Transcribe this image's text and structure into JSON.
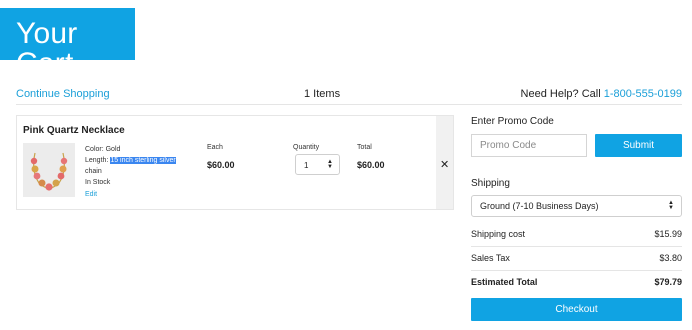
{
  "header": {
    "title": "Your Cart"
  },
  "topbar": {
    "continue_label": "Continue Shopping",
    "items_count": "1 Items",
    "help_text": "Need Help? Call ",
    "phone": "1-800-555-0199"
  },
  "cart": {
    "items": [
      {
        "name": "Pink Quartz Necklace",
        "color_text": "Color: Gold",
        "length_prefix": "Length: ",
        "length_value": "15 inch sterling silver",
        "length_suffix": "chain",
        "stock": "In Stock",
        "edit_label": "Edit",
        "each_label": "Each",
        "each_value": "$60.00",
        "quantity_label": "Quantity",
        "quantity": "1",
        "total_label": "Total",
        "total_value": "$60.00",
        "remove_symbol": "✕"
      }
    ]
  },
  "summary": {
    "promo_label": "Enter Promo Code",
    "promo_placeholder": "Promo Code",
    "submit_label": "Submit",
    "shipping_label": "Shipping",
    "shipping_selected": "Ground (7-10 Business Days)",
    "shipping_cost_label": "Shipping cost",
    "shipping_cost_value": "$15.99",
    "sales_tax_label": "Sales Tax",
    "sales_tax_value": "$3.80",
    "estimated_total_label": "Estimated Total",
    "estimated_total_value": "$79.79",
    "checkout_label": "Checkout"
  },
  "colors": {
    "accent": "#10a3e3",
    "link": "#1b9fd8",
    "highlight": "#3a86f0"
  }
}
